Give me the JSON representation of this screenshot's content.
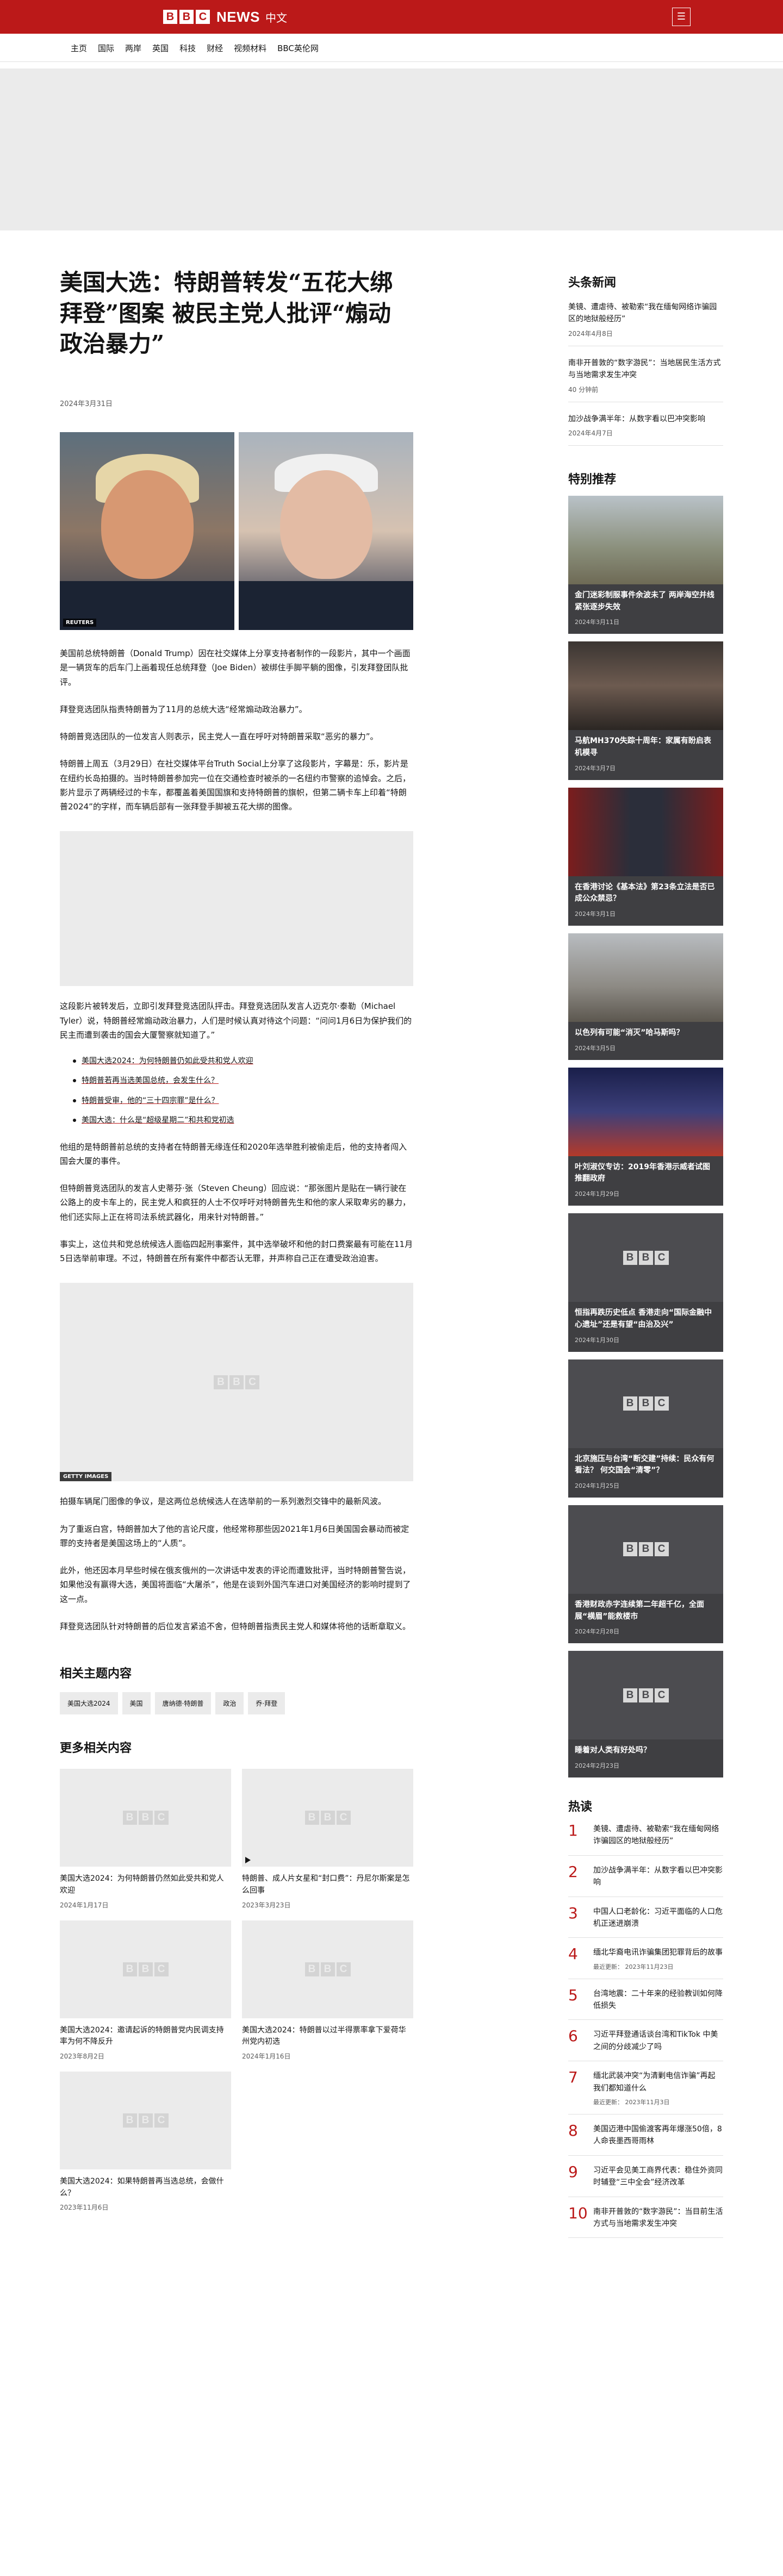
{
  "header": {
    "logo_letters": [
      "B",
      "B",
      "C"
    ],
    "logo_news": "NEWS",
    "logo_lang": "中文",
    "menu_label": "☰"
  },
  "nav": [
    "主页",
    "国际",
    "两岸",
    "英国",
    "科技",
    "财经",
    "视频材料",
    "BBC英伦网"
  ],
  "article": {
    "title": "美国大选：特朗普转发“五花大绑拜登”图案 被民主党人批评“煽动政治暴力”",
    "date": "2024年3月31日",
    "hero_credit": "REUTERS",
    "p1": "美国前总统特朗普（Donald Trump）因在社交媒体上分享支持者制作的一段影片，其中一个画面是一辆货车的后车门上画着现任总统拜登（Joe Biden）被绑住手脚平躺的图像，引发拜登团队批评。",
    "p2": "拜登竞选团队指责特朗普为了11月的总统大选“经常煽动政治暴力”。",
    "p3": "特朗普竞选团队的一位发言人则表示，民主党人一直在呼吁对特朗普采取“恶劣的暴力”。",
    "p4": "特朗普上周五（3月29日）在社交媒体平台Truth Social上分享了这段影片，字幕是：乐，影片是在纽约长岛拍摄的。当时特朗普参加完一位在交通检查时被杀的一名纽约市警察的追悼会。之后，影片显示了两辆经过的卡车，都覆盖着美国国旗和支持特朗普的旗帜，但第二辆卡车上印着“特朗普2024”的字样，而车辆后部有一张拜登手脚被五花大绑的图像。",
    "p5": "这段影片被转发后，立即引发拜登竞选团队抨击。拜登竞选团队发言人迈克尔·泰勒（Michael Tyler）说，特朗普经常煽动政治暴力，人们是时候认真对待这个问题：“问问1月6日为保护我们的民主而遭到袭击的国会大厦警察就知道了。”",
    "bullets": [
      "美国大选2024：为何特朗普仍如此受共和党人欢迎",
      "特朗普若再当选美国总统，会发生什么？",
      "特朗普受审，他的“三十四宗罪”是什么？",
      "美国大选：什么是“超级星期二”和共和党初选"
    ],
    "p6": "他组的是特朗普前总统的支持者在特朗普无缘连任和2020年选举胜利被偷走后，他的支持者闯入国会大厦的事件。",
    "p7": "但特朗普竞选团队的发言人史蒂芬·张（Steven Cheung）回应说：“那张图片是贴在一辆行驶在公路上的皮卡车上的，民主党人和疯狂的人士不仅呼吁对特朗普先生和他的家人采取卑劣的暴力，他们还实际上正在将司法系统武器化，用来针对特朗普。”",
    "p8": "事实上，这位共和党总统候选人面临四起刑事案件，其中选举破坏和他的封口费案最有可能在11月5日选举前审理。不过，特朗普在所有案件中都否认无罪，并声称自己正在遭受政治迫害。",
    "image2_credit": "GETTY IMAGES",
    "p9": "拍摄车辆尾门图像的争议，是这两位总统候选人在选举前的一系列激烈交锋中的最新风波。",
    "p10": "为了重返白宫，特朗普加大了他的言论尺度，他经常称那些因2021年1月6日美国国会暴动而被定罪的支持者是美国这场上的“人质”。",
    "p11": "此外，他还因本月早些时候在俄亥俄州的一次讲话中发表的评论而遭致批评，当时特朗普警告说，如果他没有赢得大选，美国将面临“大屠杀”，他是在谈到外国汽车进口对美国经济的影响时提到了这一点。",
    "p12": "拜登竞选团队针对特朗普的后位发言紧追不舍，但特朗普指责民主党人和媒体将他的话断章取义。"
  },
  "related_topics": {
    "title": "相关主题内容",
    "tags": [
      "美国大选2024",
      "美国",
      "唐纳德·特朗普",
      "政治",
      "乔·拜登"
    ]
  },
  "more_related": {
    "title": "更多相关内容",
    "items": [
      {
        "title": "美国大选2024：为何特朗普仍然如此受共和党人欢迎",
        "date": "2024年1月17日"
      },
      {
        "title": "特朗普、成人片女星和“封口费”：丹尼尔斯案是怎么回事",
        "date": "2023年3月23日"
      },
      {
        "title": "美国大选2024：邀请起诉的特朗普党内民调支持率为何不降反升",
        "date": "2023年8月2日"
      },
      {
        "title": "美国大选2024：特朗普以过半得票率拿下爱荷华州党内初选",
        "date": "2024年1月16日"
      },
      {
        "title": "美国大选2024：如果特朗普再当选总统，会做什么？",
        "date": "2023年11月6日"
      }
    ]
  },
  "sidebar": {
    "headlines_title": "头条新闻",
    "headlines": [
      {
        "title": "美镜、遭虐待、被勒索“我在缅甸网络诈骗园区的地狱般经历”",
        "date": "2024年4月8日"
      },
      {
        "title": "南非开普敦的“数字游民”：当地居民生活方式与当地需求发生冲突",
        "date": "40 分钟前"
      },
      {
        "title": "加沙战争满半年：从数字看以巴冲突影响",
        "date": "2024年4月7日"
      }
    ],
    "featured_title": "特别推荐",
    "featured": [
      {
        "title": "金门迷彩制服事件余波未了 两岸海空并线紧张逐步失效",
        "date": "2024年3月11日"
      },
      {
        "title": "马航MH370失踪十周年：家属有盼启表机模寻",
        "date": "2024年3月7日"
      },
      {
        "title": "在香港讨论《基本法》第23条立法是否已成公众禁忌？",
        "date": "2024年3月1日"
      },
      {
        "title": "以色列有可能“消灭”哈马斯吗？",
        "date": "2024年3月5日"
      },
      {
        "title": "叶刘淑仪专访：2019年香港示威者试图推翻政府",
        "date": "2024年1月29日"
      },
      {
        "title": "恒指再跌历史低点 香港走向“国际金融中心遗址”还是有望“由治及兴”",
        "date": "2024年1月30日"
      },
      {
        "title": "北京施压与台湾“断交建”持续：民众有何看法？ 何交国会“清零”？",
        "date": "2024年1月25日"
      },
      {
        "title": "香港财政赤字连续第二年超千亿，全面展“横眉”能救楼市",
        "date": "2024年2月28日"
      },
      {
        "title": "睡着对人类有好处吗？",
        "date": "2024年2月23日"
      }
    ],
    "popular_title": "热读",
    "popular": [
      {
        "n": "1",
        "title": "美镜、遭虐待、被勒索“我在缅甸网络诈骗园区的地狱般经历”",
        "meta": ""
      },
      {
        "n": "2",
        "title": "加沙战争满半年：从数字看以巴冲突影响",
        "meta": ""
      },
      {
        "n": "3",
        "title": "中国人口老龄化：习近平面临的人口危机正迷进崩溃",
        "meta": ""
      },
      {
        "n": "4",
        "title": "缅北华裔电讯诈骗集团犯罪背后的故事",
        "meta": "最近更新： 2023年11月23日"
      },
      {
        "n": "5",
        "title": "台湾地震：二十年来的经验教训如何降低损失",
        "meta": ""
      },
      {
        "n": "6",
        "title": "习近平拜登通话谈台湾和TikTok 中美之间的分歧减少了吗",
        "meta": ""
      },
      {
        "n": "7",
        "title": "缅北武装冲突“为清剿电信诈骗”再起 我们都知道什么",
        "meta": "最近更新： 2023年11月3日"
      },
      {
        "n": "8",
        "title": "美国迈港中国偷渡客再年爆涨50倍，8人命丧墨西哥雨林",
        "meta": ""
      },
      {
        "n": "9",
        "title": "习近平会见美工商界代表：稳住外资同时辅登“三中全会”经济改革",
        "meta": ""
      },
      {
        "n": "10",
        "title": "南非开普敦的“数字游民”：当目前生活方式与当地需求发生冲突",
        "meta": ""
      }
    ]
  }
}
